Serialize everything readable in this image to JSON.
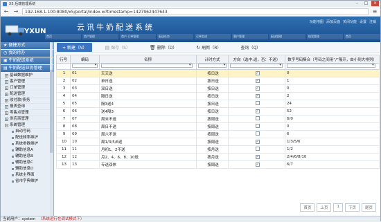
{
  "window": {
    "title": "X5 后端管理系统"
  },
  "browser": {
    "url": "192.168.1.100:8080/x5/portal/index.w?timestamp=1427962447643",
    "back": "←",
    "forward": "→",
    "menu": "≡"
  },
  "header": {
    "brand": "YXUN",
    "app_title": "云讯牛奶配送系统",
    "top_links": [
      "功能地图",
      "添加页面",
      "关闭功能",
      "设置",
      "注销"
    ],
    "nav_tabs": [
      "首页",
      "首户管理",
      "首户 订单管理",
      "配送任务",
      "订单生成",
      "客户管理",
      "配送管理",
      "档案管理",
      "首页"
    ]
  },
  "sidebar": {
    "heads": [
      "便捷方式",
      "我的待办",
      "牛奶配送系统",
      "牛奶配送业务管理"
    ],
    "items": [
      "基础数据维护",
      "客户管理",
      "订单管理",
      "配送管理",
      "收付款/债务",
      "报表查询",
      "零售点管理",
      "供应商管理",
      "系统管理"
    ],
    "sub_items": [
      "自动号码",
      "配送频率维护",
      "系统参数维护",
      "辅助信息A",
      "辅助信息B",
      "辅助信息C",
      "辅助信息D",
      "系统主界面",
      "省市字典维护"
    ]
  },
  "toolbar": {
    "new": "+ 新建（N）",
    "save": "保存（S）",
    "delete": "删除（D）",
    "refresh": "刷新（R）",
    "query": "查询（Q）"
  },
  "table": {
    "headers": [
      "行号",
      "编码",
      "名称",
      "计时方式",
      "方向（选中:送，否：不送）",
      "数字号码集合（号码之间用“/”隔开，由小到大排列）"
    ],
    "rows": [
      {
        "no": "1",
        "code": "01",
        "name": "天天送",
        "mode": "按日送",
        "checked": true,
        "nums": "0"
      },
      {
        "no": "2",
        "code": "02",
        "name": "单日送",
        "mode": "按日送",
        "checked": true,
        "nums": "1"
      },
      {
        "no": "3",
        "code": "03",
        "name": "双日送",
        "mode": "按日送",
        "checked": true,
        "nums": "0"
      },
      {
        "no": "4",
        "code": "04",
        "name": "隔日送",
        "mode": "按日送",
        "checked": true,
        "nums": "2"
      },
      {
        "no": "5",
        "code": "05",
        "name": "隔3送4",
        "mode": "按日送",
        "checked": false,
        "nums": "24"
      },
      {
        "no": "6",
        "code": "06",
        "name": "送4隔3",
        "mode": "按日送",
        "checked": true,
        "nums": "52"
      },
      {
        "no": "7",
        "code": "07",
        "name": "周末不送",
        "mode": "按周送",
        "checked": false,
        "nums": "6/0"
      },
      {
        "no": "8",
        "code": "08",
        "name": "周日不送",
        "mode": "按周送",
        "checked": false,
        "nums": "0"
      },
      {
        "no": "9",
        "code": "09",
        "name": "周六不送",
        "mode": "按周送",
        "checked": false,
        "nums": "6"
      },
      {
        "no": "10",
        "code": "10",
        "name": "周1/3/5/6送",
        "mode": "按周送",
        "checked": true,
        "nums": "1/3/5/6"
      },
      {
        "no": "11",
        "code": "11",
        "name": "月初1、2不送",
        "mode": "按月送",
        "checked": false,
        "nums": "1/2"
      },
      {
        "no": "12",
        "code": "12",
        "name": "月2、4、6、8、10送",
        "mode": "按月送",
        "checked": true,
        "nums": "2/4/6/8/10"
      },
      {
        "no": "13",
        "code": "13",
        "name": "专送双休",
        "mode": "按周送",
        "checked": true,
        "nums": "6/7"
      }
    ]
  },
  "pager": {
    "first": "首页",
    "prev": "上页",
    "page": "1",
    "next": "下页",
    "last": "尾页"
  },
  "status": {
    "user": "当前用户：system",
    "warning": "（系统运行在调试模式下）"
  }
}
